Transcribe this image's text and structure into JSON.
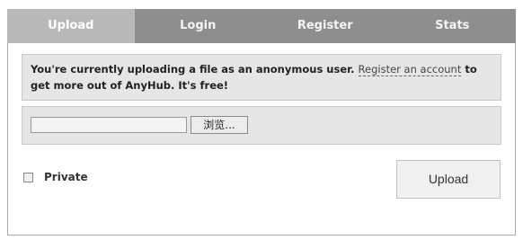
{
  "tabs": [
    {
      "label": "Upload",
      "active": true
    },
    {
      "label": "Login",
      "active": false
    },
    {
      "label": "Register",
      "active": false
    },
    {
      "label": "Stats",
      "active": false
    }
  ],
  "notice": {
    "text_before": "You're currently uploading a file as an anonymous user.",
    "link_text": "Register an account",
    "text_after": "to get more out of AnyHub. It's free!"
  },
  "file_input": {
    "value": "",
    "browse_label": "浏览..."
  },
  "private_checkbox": {
    "label": "Private",
    "checked": false
  },
  "upload_button": {
    "label": "Upload"
  },
  "colors": {
    "tabbar": "#8e8e8e",
    "tab_active": "#b9b9b9",
    "panel": "#e6e6e6"
  }
}
